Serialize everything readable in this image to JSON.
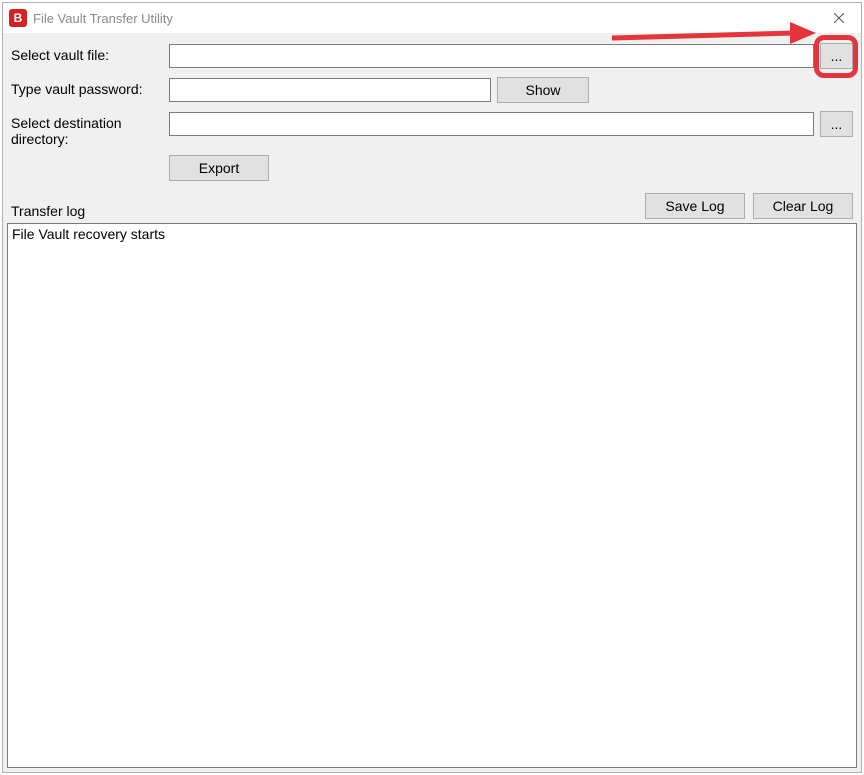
{
  "window": {
    "title": "File Vault Transfer Utility",
    "icon_letter": "B"
  },
  "form": {
    "vault_label": "Select vault file:",
    "vault_value": "",
    "browse_label": "...",
    "password_label": "Type vault password:",
    "password_value": "",
    "show_label": "Show",
    "dest_label": "Select destination directory:",
    "dest_value": "",
    "dest_browse_label": "...",
    "export_label": "Export"
  },
  "log": {
    "title": "Transfer log",
    "save_label": "Save Log",
    "clear_label": "Clear Log",
    "content": "File Vault recovery starts"
  }
}
